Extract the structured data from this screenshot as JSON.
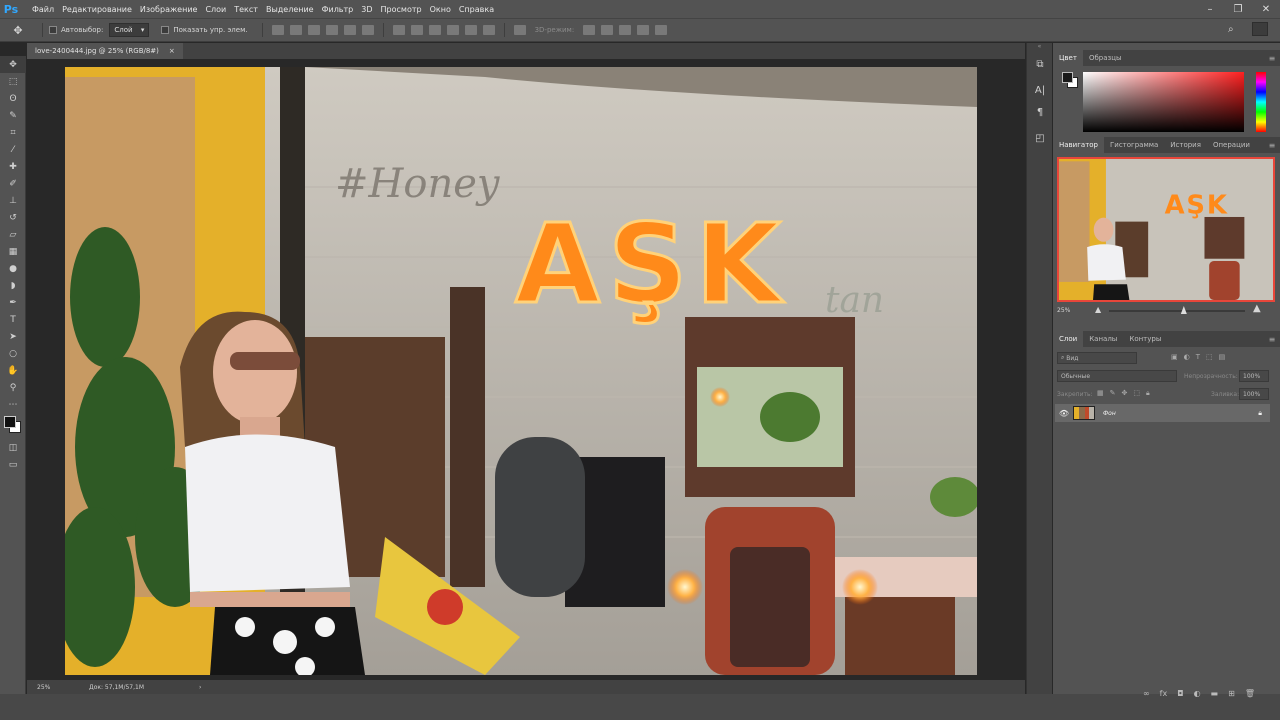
{
  "app": {
    "logo": "Ps",
    "accent": "#31a8ff"
  },
  "menu": [
    "Файл",
    "Редактирование",
    "Изображение",
    "Слои",
    "Текст",
    "Выделение",
    "Фильтр",
    "3D",
    "Просмотр",
    "Окно",
    "Справка"
  ],
  "options": {
    "autoselect_label": "Автовыбор:",
    "autoselect_value": "Слой",
    "show_transform_label": "Показать упр. элем.",
    "mode_3d_label": "3D-режим:"
  },
  "document": {
    "tab_title": "love-2400444.jpg @ 25% (RGB/8#)",
    "tab_close": "×",
    "photo_sign_text": "AŞK",
    "photo_script_text": "#Honey",
    "photo_script2_text": "tan"
  },
  "status": {
    "zoom": "25%",
    "doc_info": "Док: 57,1M/57,1M",
    "arrow": "›"
  },
  "color_panel": {
    "tabs": [
      "Цвет",
      "Образцы"
    ],
    "active_tab": 0,
    "foreground": "#1a1a1a",
    "background": "#ffffff",
    "hue_color": "#ff2020"
  },
  "navigator_panel": {
    "tabs": [
      "Навигатор",
      "Гистограмма",
      "История",
      "Операции"
    ],
    "active_tab": 0,
    "zoom": "25%",
    "zoom_slider_fraction": 0.55
  },
  "layers_panel": {
    "tabs": [
      "Слои",
      "Каналы",
      "Контуры"
    ],
    "active_tab": 0,
    "search_placeholder": "Вид",
    "blend_mode": "Обычные",
    "opacity_label": "Непрозрачность:",
    "opacity_value": "100%",
    "lock_label": "Закрепить:",
    "fill_label": "Заливка:",
    "fill_value": "100%",
    "layers": [
      {
        "name": "Фон",
        "visible": true,
        "locked": true
      }
    ]
  }
}
